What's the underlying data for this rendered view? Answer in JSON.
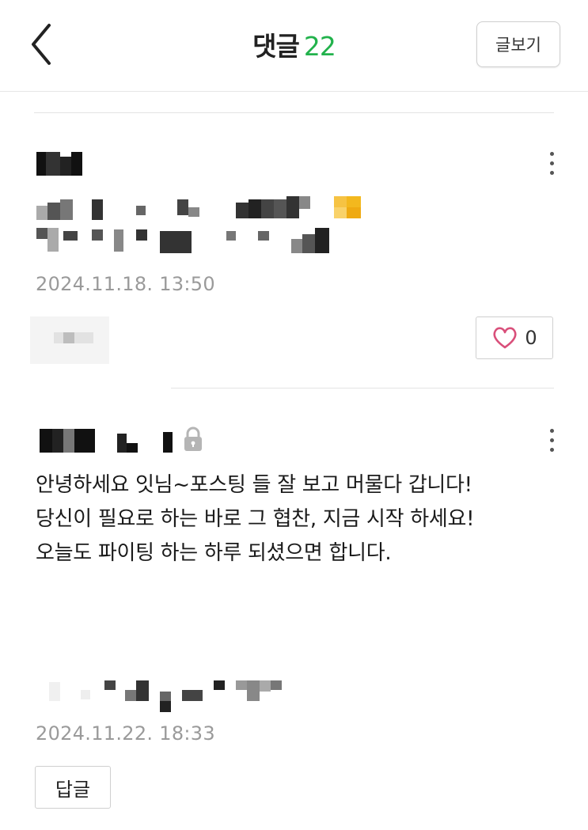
{
  "header": {
    "title": "댓글",
    "comment_count": "22",
    "view_post_label": "글보기",
    "back_icon": "chevron-left-icon"
  },
  "comments": [
    {
      "author": "",
      "text": "",
      "timestamp": "2024.11.18. 13:50",
      "like_count": "0",
      "more_icon": "more-vertical-icon",
      "like_icon": "heart-outline-icon"
    },
    {
      "author": "",
      "secret": true,
      "lock_icon": "lock-icon",
      "more_icon": "more-vertical-icon",
      "text_lines": [
        "안녕하세요 잇님~포스팅 들 잘 보고 머물다 갑니다!",
        "당신이 필요로 하는 바로 그 협찬, 지금 시작 하세요!",
        "오늘도 파이팅 하는 하루 되셨으면 합니다."
      ],
      "timestamp": "2024.11.22. 18:33",
      "reply_label": "답글"
    }
  ],
  "colors": {
    "accent_green": "#22b24c",
    "heart_pink": "#d94f7a",
    "timestamp_gray": "#9a9a9a"
  }
}
